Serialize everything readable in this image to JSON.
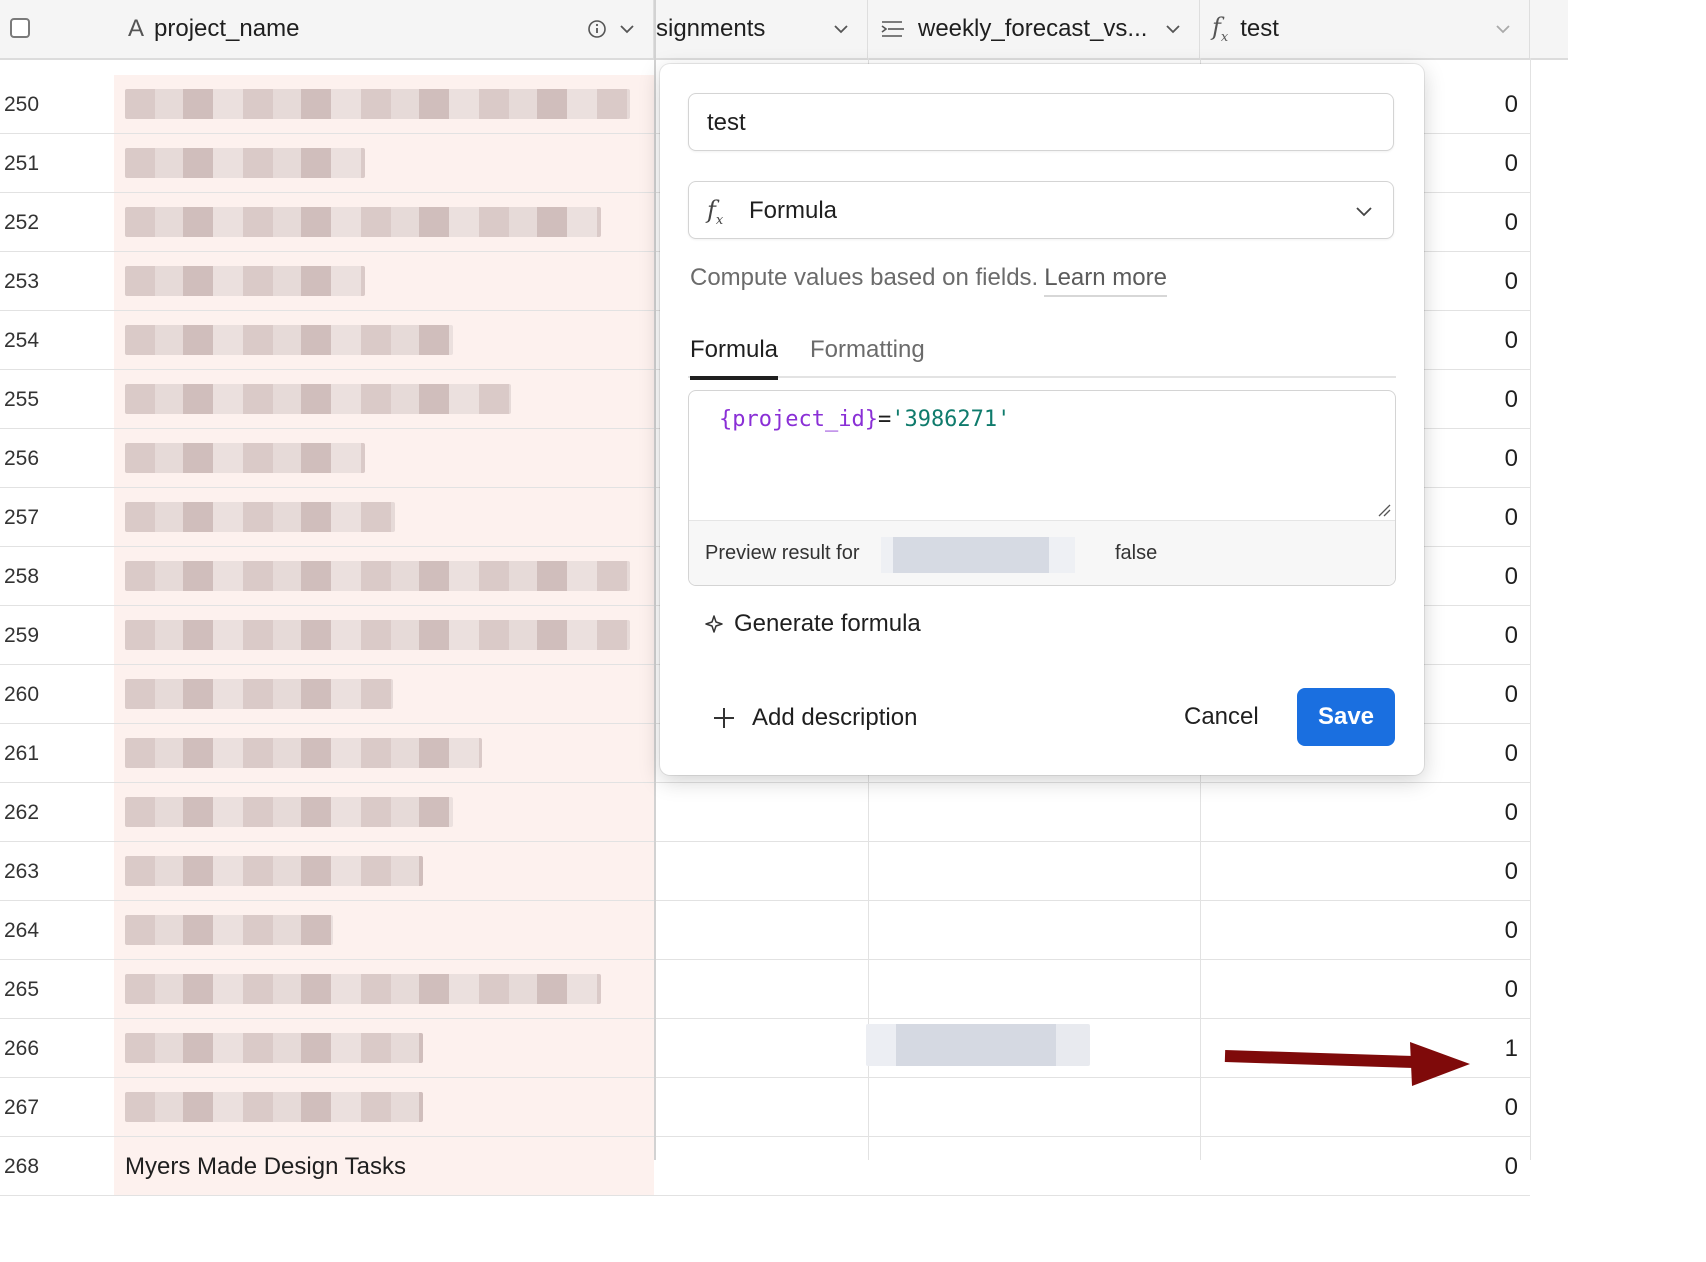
{
  "header": {
    "project_name": "project_name",
    "assignments": "signments",
    "weekly": "weekly_forecast_vs...",
    "test": "test"
  },
  "rows": [
    {
      "num": "250",
      "value": "0",
      "w": 505
    },
    {
      "num": "251",
      "value": "0",
      "w": 240
    },
    {
      "num": "252",
      "value": "0",
      "w": 476
    },
    {
      "num": "253",
      "value": "0",
      "w": 240
    },
    {
      "num": "254",
      "value": "0",
      "w": 328
    },
    {
      "num": "255",
      "value": "0",
      "w": 386
    },
    {
      "num": "256",
      "value": "0",
      "w": 240
    },
    {
      "num": "257",
      "value": "0",
      "w": 270
    },
    {
      "num": "258",
      "value": "0",
      "w": 505
    },
    {
      "num": "259",
      "value": "0",
      "w": 505
    },
    {
      "num": "260",
      "value": "0",
      "w": 268
    },
    {
      "num": "261",
      "value": "0",
      "w": 357
    },
    {
      "num": "262",
      "value": "0",
      "w": 328
    },
    {
      "num": "263",
      "value": "0",
      "w": 298
    },
    {
      "num": "264",
      "value": "0",
      "w": 208
    },
    {
      "num": "265",
      "value": "0",
      "w": 476
    },
    {
      "num": "266",
      "value": "1",
      "w": 298
    },
    {
      "num": "267",
      "value": "0",
      "w": 298
    }
  ],
  "partial_row": {
    "num": "268",
    "name": "Myers Made Design Tasks",
    "value": "0"
  },
  "modal": {
    "field_name": "test",
    "field_type": "Formula",
    "description": "Compute values based on fields.",
    "learn_more": "Learn more",
    "tab_formula": "Formula",
    "tab_formatting": "Formatting",
    "formula_field": "{project_id}",
    "formula_op": "=",
    "formula_string": "'3986271'",
    "preview_label": "Preview result for",
    "preview_result": "false",
    "generate": "Generate formula",
    "add_description": "Add description",
    "cancel": "Cancel",
    "save": "Save"
  },
  "colors": {
    "save": "#1a6fe0",
    "arrow": "#7f0a0a",
    "formula_field": "#8a2fd6",
    "formula_string": "#0f7b6c",
    "frozen_bg": "#fdf1ee"
  },
  "icons": {
    "text_field": "A",
    "info": "info-icon",
    "formula": "fx-icon",
    "rollup": "rollup-icon",
    "sparkle": "sparkle-icon",
    "plus": "plus-icon"
  }
}
